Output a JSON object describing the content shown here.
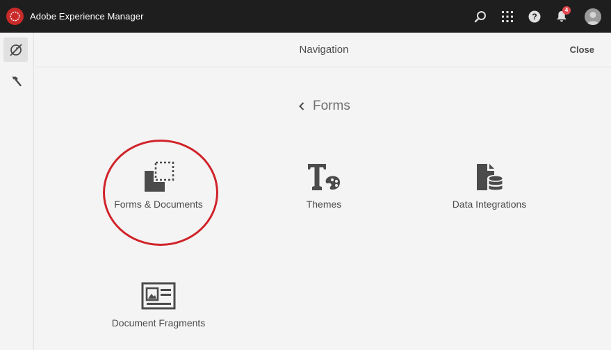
{
  "app": {
    "title": "Adobe Experience Manager"
  },
  "topbar": {
    "notifications_count": "4",
    "icons": [
      "search-icon",
      "apps-grid-icon",
      "help-icon",
      "bell-icon",
      "user-avatar"
    ]
  },
  "rail": {
    "items": [
      "navigation-icon",
      "tools-hammer-icon"
    ]
  },
  "panel": {
    "title": "Navigation",
    "close_label": "Close",
    "back_label": "Forms"
  },
  "tiles": [
    {
      "label": "Forms & Documents",
      "icon": "forms-documents-icon"
    },
    {
      "label": "Themes",
      "icon": "themes-icon"
    },
    {
      "label": "Data Integrations",
      "icon": "data-integrations-icon"
    },
    {
      "label": "Document Fragments",
      "icon": "document-fragments-icon"
    }
  ],
  "colors": {
    "shell": "#1e1e1e",
    "background": "#f4f4f4",
    "icon": "#4b4b4b",
    "annotation": "#d0232a",
    "badge": "#e34850"
  }
}
